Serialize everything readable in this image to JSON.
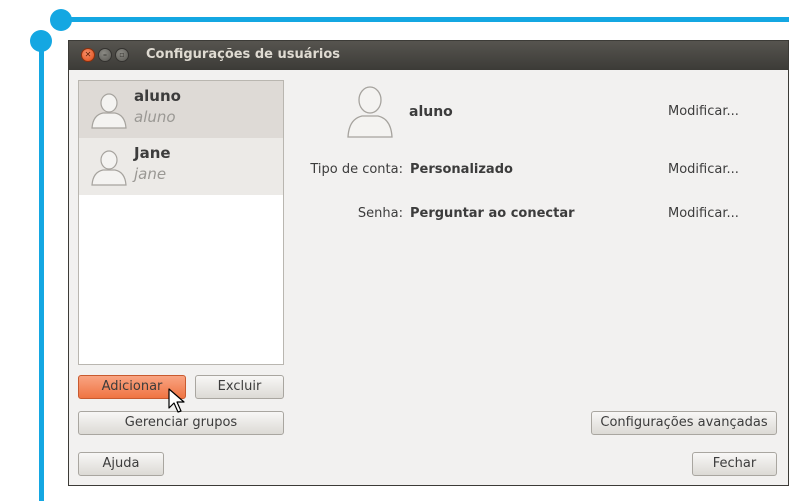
{
  "window": {
    "title": "Configurações de usuários"
  },
  "users": [
    {
      "name": "aluno",
      "login": "aluno"
    },
    {
      "name": "Jane",
      "login": "jane"
    }
  ],
  "details": {
    "name": "aluno",
    "name_action": "Modificar...",
    "account_type_label": "Tipo de conta:",
    "account_type_value": "Personalizado",
    "account_type_action": "Modificar...",
    "password_label": "Senha:",
    "password_value": "Perguntar ao conectar",
    "password_action": "Modificar..."
  },
  "buttons": {
    "add": "Adicionar",
    "delete": "Excluir",
    "manage_groups": "Gerenciar grupos",
    "advanced": "Configurações avançadas",
    "help": "Ajuda",
    "close": "Fechar"
  }
}
